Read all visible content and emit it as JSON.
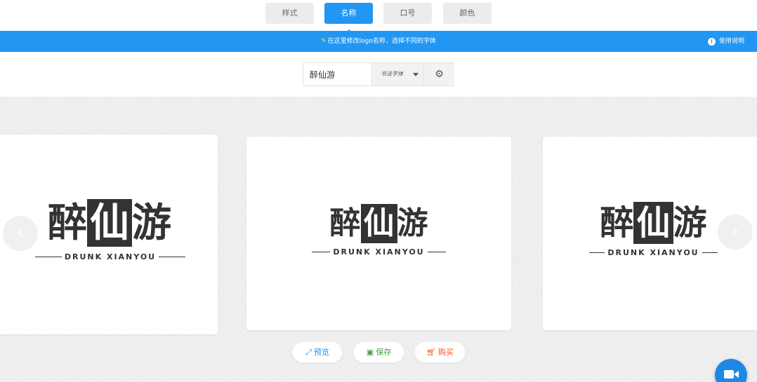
{
  "tabs": [
    {
      "label": "样式",
      "active": false
    },
    {
      "label": "名称",
      "active": true
    },
    {
      "label": "口号",
      "active": false
    },
    {
      "label": "颜色",
      "active": false
    }
  ],
  "hint": {
    "text": "在这里修改logo名称，选择不同的字体",
    "icon": "lightbulb-icon"
  },
  "help": {
    "label": "使用说明",
    "icon": "info-icon"
  },
  "editor": {
    "name_value": "醉仙游",
    "font_label": "书法字体",
    "settings_icon": "gear-icon"
  },
  "logo": {
    "char1": "醉",
    "char2": "仙",
    "char3": "游",
    "subtitle": "DRUNK XIANYOU"
  },
  "actions": {
    "preview": "预览",
    "save": "保存",
    "buy": "购买"
  },
  "colors": {
    "accent": "#2196f3",
    "preview": "#2196f3",
    "save": "#43a047",
    "buy": "#f4511e"
  }
}
